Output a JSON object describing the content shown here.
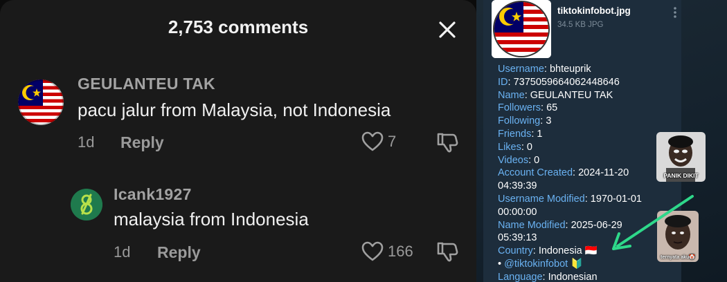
{
  "comments_sheet": {
    "title": "2,753 comments",
    "comments": [
      {
        "username": "GEULANTEU TAK",
        "text": "pacu jalur from Malaysia, not Indonesia",
        "time": "1d",
        "reply_label": "Reply",
        "likes": "7",
        "avatar_icon": "malaysia-flag-avatar"
      },
      {
        "username": "Icank1927",
        "text": "malaysia from Indonesia",
        "time": "1d",
        "reply_label": "Reply",
        "likes": "166",
        "avatar_icon": "green-logo-avatar"
      }
    ]
  },
  "telegram_message": {
    "file_name": "tiktokinfobot.jpg",
    "file_meta": "34.5 KB JPG",
    "fields": [
      {
        "label": "Username",
        "value": "bhteuprik"
      },
      {
        "label": "ID",
        "value": "7375059664062448646"
      },
      {
        "label": "Name",
        "value": "GEULANTEU TAK"
      },
      {
        "label": "Followers",
        "value": "65"
      },
      {
        "label": "Following",
        "value": "3"
      },
      {
        "label": "Friends",
        "value": "1"
      },
      {
        "label": "Likes",
        "value": "0"
      },
      {
        "label": "Videos",
        "value": "0"
      },
      {
        "label": "Account Created",
        "value": "2024-11-20",
        "value2": "04:39:39"
      },
      {
        "label": "Username Modified",
        "value": "1970-01-01",
        "value2": "00:00:00"
      },
      {
        "label": "Name Modified",
        "value": "2025-06-29",
        "value2": "05:39:13"
      },
      {
        "label": "Country",
        "value": "Indonesia 🇮🇩"
      },
      {
        "label": "Language",
        "value": "Indonesian"
      }
    ],
    "bot_link": "@tiktokinfobot",
    "bullet": "•",
    "bot_emoji": "🔰"
  },
  "stickers": {
    "top_caption": "PANIK DIKIT",
    "bottom_caption": "ternyata aku🤡"
  },
  "colors": {
    "sheet_bg": "#1a1a1a",
    "telegram_bubble": "#1d2d3c",
    "telegram_link": "#6ab2f2",
    "annotation_arrow": "#2ed88a"
  }
}
